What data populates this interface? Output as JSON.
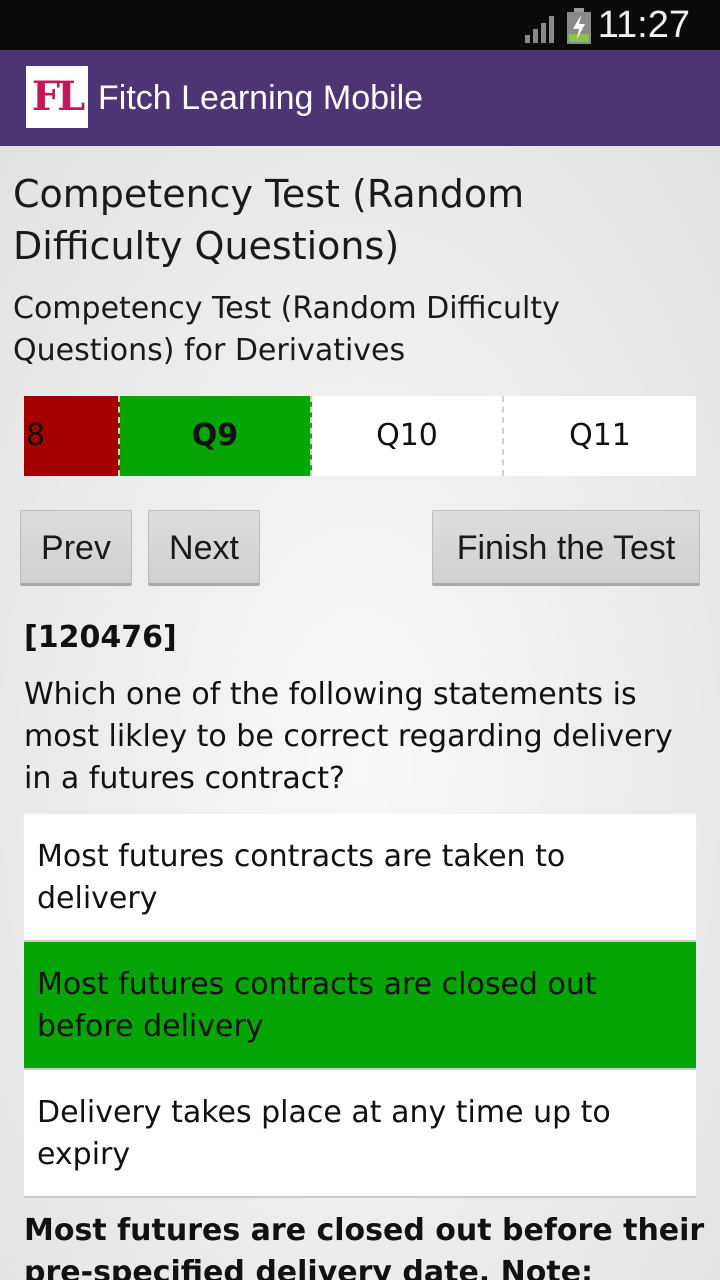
{
  "status_bar": {
    "time": "11:27",
    "icons": [
      "signal-icon",
      "battery-charging-icon"
    ]
  },
  "app_bar": {
    "logo_text": "FL",
    "title": "Fitch Learning Mobile",
    "color": "#4d3474"
  },
  "page": {
    "title": "Competency Test (Random Difficulty Questions)",
    "subtitle": "Competency Test (Random Difficulty Questions) for Derivatives"
  },
  "question_nav": {
    "tabs": [
      {
        "label": "8",
        "state": "incorrect",
        "color": "#a50000"
      },
      {
        "label": "Q9",
        "state": "current",
        "color": "#04a504"
      },
      {
        "label": "Q10",
        "state": "unanswered",
        "color": "#ffffff"
      },
      {
        "label": "Q11",
        "state": "unanswered",
        "color": "#ffffff"
      }
    ]
  },
  "buttons": {
    "prev": "Prev",
    "next": "Next",
    "finish": "Finish the Test"
  },
  "question": {
    "id": "[120476]",
    "text": "Which one of the following statements is most likley to be correct regarding delivery in a futures contract?",
    "answers": [
      {
        "text": "Most futures contracts are taken to delivery",
        "selected": false
      },
      {
        "text": "Most futures contracts are closed out before delivery",
        "selected": true
      },
      {
        "text": "Delivery takes place at any time up to expiry",
        "selected": false
      }
    ],
    "explanation": "Most futures are closed out before their pre-specified delivery date. Note: Futures"
  }
}
